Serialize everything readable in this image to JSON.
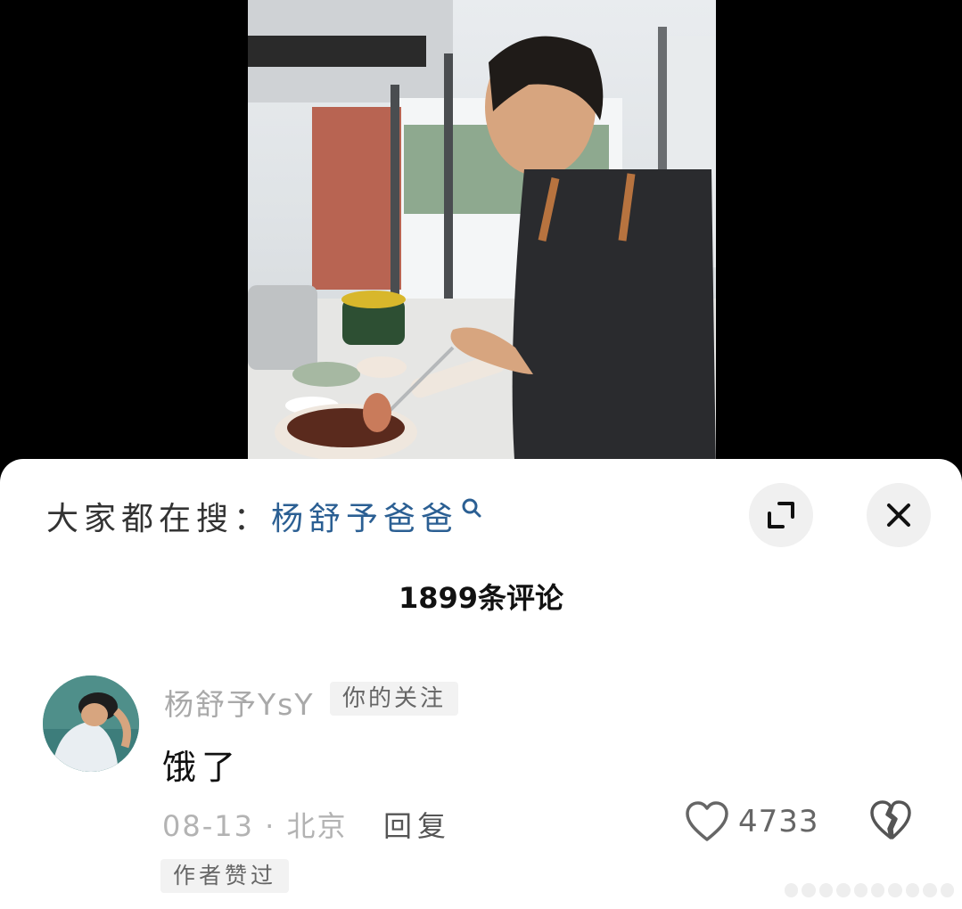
{
  "trending": {
    "prefix": "大家都在搜：",
    "keyword": "杨舒予爸爸"
  },
  "comments_header": {
    "count_label": "1899条评论"
  },
  "comment": {
    "username": "杨舒予YsY",
    "follow_badge": "你的关注",
    "text": "饿了",
    "date_location": "08-13 · 北京",
    "reply_label": "回复",
    "like_count": "4733",
    "author_liked_badge": "作者赞过"
  },
  "colors": {
    "keyword": "#2b5f93",
    "sheet_bg": "#ffffff",
    "backdrop": "#000000"
  },
  "icons": [
    "search-icon",
    "expand-icon",
    "close-icon",
    "heart-icon",
    "broken-heart-icon"
  ]
}
